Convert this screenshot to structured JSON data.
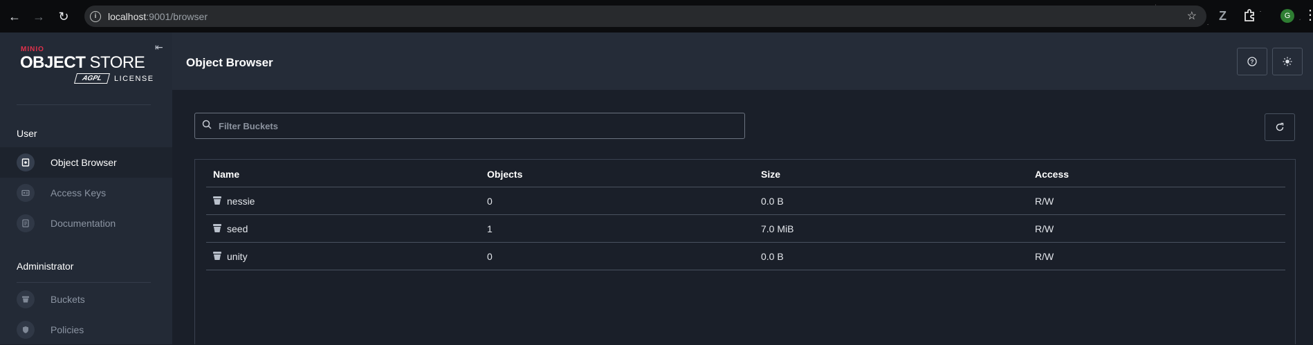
{
  "browser": {
    "url_host": "localhost",
    "url_rest": ":9001/browser",
    "avatar_letter": "G"
  },
  "sidebar": {
    "logo": {
      "brand": "MINIO",
      "product_bold": "OBJECT",
      "product_light": "STORE",
      "license_badge": "AGPL",
      "license_text": "LICENSE"
    },
    "sections": [
      {
        "title": "User",
        "items": [
          {
            "label": "Object Browser",
            "icon": "object-browser-icon",
            "active": true
          },
          {
            "label": "Access Keys",
            "icon": "access-keys-icon",
            "active": false
          },
          {
            "label": "Documentation",
            "icon": "documentation-icon",
            "active": false
          }
        ]
      },
      {
        "title": "Administrator",
        "items": [
          {
            "label": "Buckets",
            "icon": "bucket-icon",
            "active": false
          },
          {
            "label": "Policies",
            "icon": "policies-icon",
            "active": false
          }
        ]
      }
    ]
  },
  "header": {
    "title": "Object Browser"
  },
  "filter": {
    "placeholder": "Filter Buckets"
  },
  "table": {
    "columns": [
      "Name",
      "Objects",
      "Size",
      "Access"
    ],
    "rows": [
      {
        "name": "nessie",
        "objects": "0",
        "size": "0.0 B",
        "access": "R/W"
      },
      {
        "name": "seed",
        "objects": "1",
        "size": "7.0 MiB",
        "access": "R/W"
      },
      {
        "name": "unity",
        "objects": "0",
        "size": "0.0 B",
        "access": "R/W"
      }
    ]
  },
  "colors": {
    "sidebar_bg": "#232a36",
    "content_bg": "#1a1f29",
    "brand_red": "#e0314b"
  }
}
